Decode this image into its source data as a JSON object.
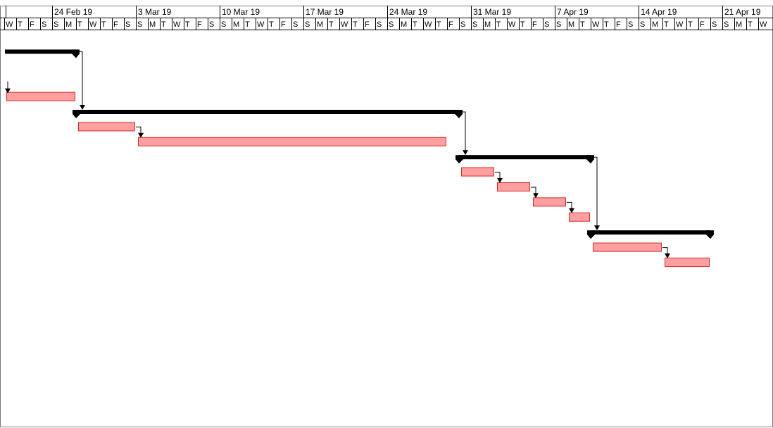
{
  "timescale": {
    "weeks": [
      "24 Feb 19",
      "3 Mar 19",
      "10 Mar 19",
      "17 Mar 19",
      "24 Mar 19",
      "31 Mar 19",
      "7 Apr 19",
      "14 Apr 19",
      "21 Apr 19"
    ],
    "day_letters": [
      "W",
      "T",
      "F",
      "S",
      "S",
      "M",
      "T",
      "W",
      "T",
      "F",
      "S",
      "S",
      "M",
      "T",
      "W",
      "T",
      "F",
      "S",
      "S",
      "M",
      "T",
      "W",
      "T",
      "F",
      "S",
      "S",
      "M",
      "T",
      "W",
      "T",
      "F",
      "S",
      "S",
      "M",
      "T",
      "W",
      "T",
      "F",
      "S",
      "S",
      "M",
      "T",
      "W",
      "T",
      "F",
      "S",
      "S",
      "M",
      "T",
      "W",
      "T",
      "F",
      "S",
      "S",
      "M",
      "T",
      "W",
      "T",
      "F",
      "S",
      "S",
      "M",
      "T",
      "W"
    ],
    "first_day": "2019-02-20"
  },
  "summary_tasks": [
    {
      "start": "2019-02-19",
      "finish": "2019-02-26"
    },
    {
      "start": "2019-02-26",
      "finish": "2019-03-30"
    },
    {
      "start": "2019-03-30",
      "finish": "2019-04-10"
    },
    {
      "start": "2019-04-10",
      "finish": "2019-04-20"
    }
  ],
  "tasks": [
    {
      "start": "2019-02-20",
      "finish": "2019-02-26",
      "row": 4
    },
    {
      "start": "2019-02-26",
      "finish": "2019-03-03",
      "row": 6
    },
    {
      "start": "2019-03-03",
      "finish": "2019-03-29",
      "row": 7
    },
    {
      "start": "2019-03-30",
      "finish": "2019-04-02",
      "row": 9
    },
    {
      "start": "2019-04-02",
      "finish": "2019-04-05",
      "row": 10
    },
    {
      "start": "2019-04-05",
      "finish": "2019-04-08",
      "row": 11
    },
    {
      "start": "2019-04-08",
      "finish": "2019-04-10",
      "row": 12
    },
    {
      "start": "2019-04-10",
      "finish": "2019-04-16",
      "row": 14
    },
    {
      "start": "2019-04-16",
      "finish": "2019-04-20",
      "row": 15
    }
  ],
  "summary_rows": [
    1,
    5,
    8,
    13
  ],
  "links": [
    {
      "from": "s0",
      "to": "s1"
    },
    {
      "from": "t1",
      "to": "t2"
    },
    {
      "from": "s1",
      "to": "s2"
    },
    {
      "from": "t3",
      "to": "t4"
    },
    {
      "from": "t4",
      "to": "t5"
    },
    {
      "from": "t5",
      "to": "t6"
    },
    {
      "from": "s2",
      "to": "s3"
    },
    {
      "from": "t7",
      "to": "t8"
    }
  ],
  "colors": {
    "task_fill": "#ff9f9f",
    "task_border": "#d42a2a",
    "summary": "#000000",
    "grid": "#000000"
  }
}
